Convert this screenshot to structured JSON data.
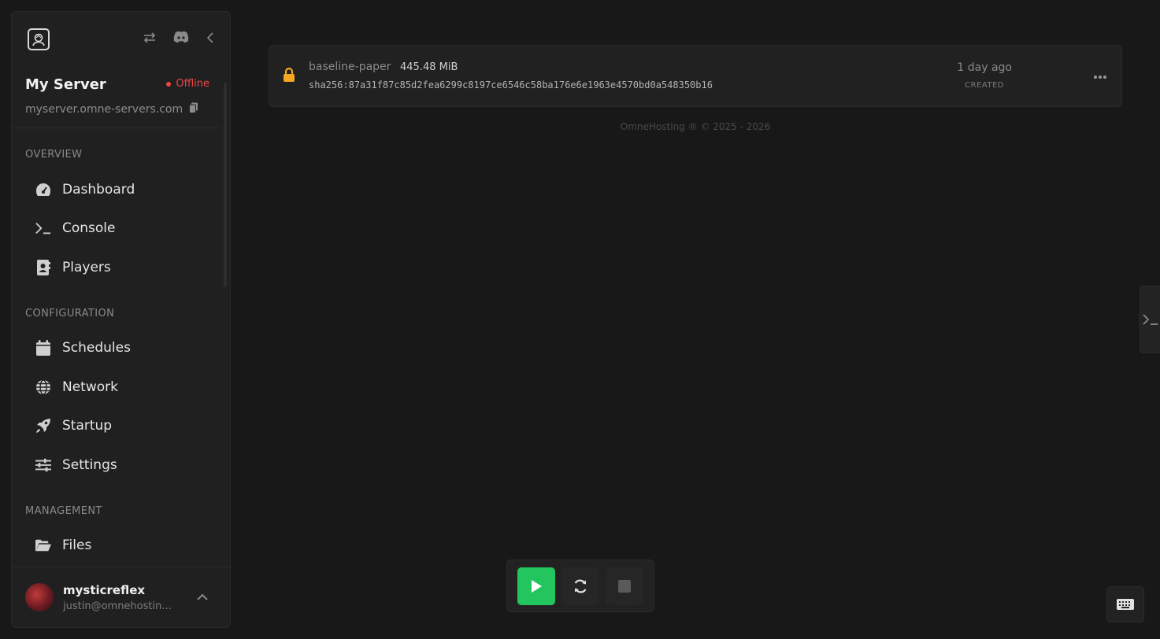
{
  "sidebar": {
    "server_name": "My Server",
    "status": "Offline",
    "address": "myserver.omne-servers.com",
    "sections": {
      "overview": "OVERVIEW",
      "configuration": "CONFIGURATION",
      "management": "MANAGEMENT"
    },
    "items": {
      "dashboard": "Dashboard",
      "console": "Console",
      "players": "Players",
      "schedules": "Schedules",
      "network": "Network",
      "startup": "Startup",
      "settings": "Settings",
      "files": "Files"
    },
    "user": {
      "name": "mysticreflex",
      "email": "justin@omnehostin..."
    }
  },
  "backup": {
    "name": "baseline-paper",
    "size": "445.48 MiB",
    "hash": "sha256:87a31f87c85d2fea6299c8197ce6546c58ba176e6e1963e4570bd0a548350b16",
    "date": "1 day ago",
    "date_label": "CREATED"
  },
  "footer": "OmneHosting ® © 2025 - 2026",
  "colors": {
    "status_offline": "#ef4444",
    "start_button": "#22c55e",
    "lock_icon": "#f5a623"
  }
}
